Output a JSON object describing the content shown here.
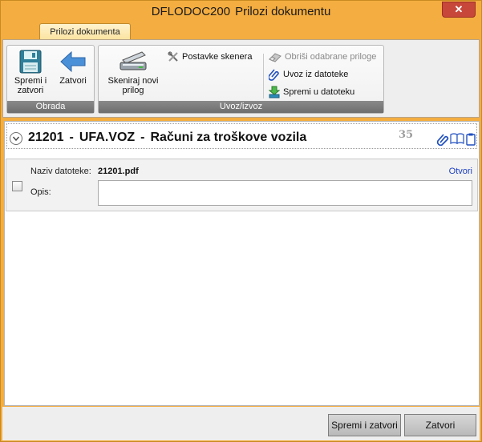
{
  "window": {
    "app_code": "DFLODOC200",
    "title": "Prilozi dokumentu",
    "close_label": "✕"
  },
  "ribbon": {
    "tab_label": "Prilozi dokumenta",
    "groups": {
      "obrada": {
        "label": "Obrada",
        "save_close_label_1": "Spremi i",
        "save_close_label_2": "zatvori",
        "close_label": "Zatvori"
      },
      "uvoz_izvoz": {
        "label": "Uvoz/izvoz",
        "scan_label_1": "Skeniraj novi",
        "scan_label_2": "prilog",
        "scanner_settings_label": "Postavke skenera",
        "delete_selected_label": "Obriši odabrane priloge",
        "import_label": "Uvoz iz datoteke",
        "save_to_file_label": "Spremi u datoteku"
      }
    }
  },
  "document": {
    "number": "21201",
    "code": "UFA.VOZ",
    "name": "Računi za troškove vozila",
    "count": "35"
  },
  "attachment": {
    "file_name_label": "Naziv datoteke:",
    "file_name": "21201.pdf",
    "open_label": "Otvori",
    "description_label": "Opis:",
    "description_value": ""
  },
  "footer": {
    "save_close_label": "Spremi i zatvori",
    "close_label": "Zatvori"
  },
  "colors": {
    "frame": "#f4ad40",
    "tab_active": "#fbe39e",
    "group_label_bg": "#7a7a7a",
    "link": "#1c3fbf",
    "close_button": "#c7473a"
  }
}
